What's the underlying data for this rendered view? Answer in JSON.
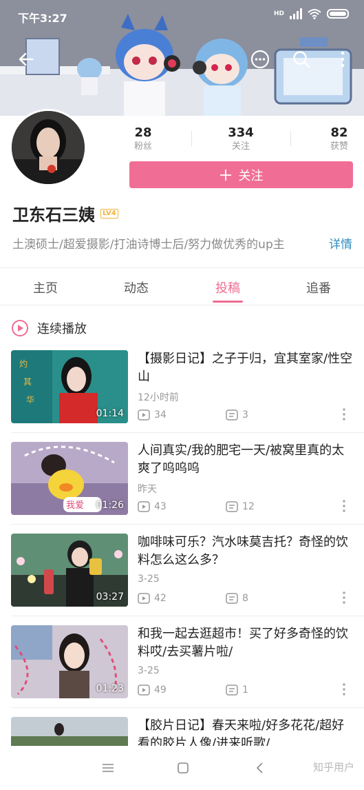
{
  "status_bar": {
    "time": "下午3:27",
    "network": "HD"
  },
  "topbar": {
    "back_icon": "back-arrow-icon",
    "more_icon": "more-dots-icon",
    "search_icon": "search-icon",
    "menu_icon": "vertical-dots-icon"
  },
  "profile": {
    "name": "卫东石三姨",
    "level": "LV4",
    "bio": "土澳硕士/超爱摄影/打油诗博士后/努力做优秀的up主",
    "detail_label": "详情",
    "follow_label": "关注",
    "stats": [
      {
        "value": "28",
        "label": "粉丝"
      },
      {
        "value": "334",
        "label": "关注"
      },
      {
        "value": "82",
        "label": "获赞"
      }
    ]
  },
  "tabs": [
    {
      "label": "主页",
      "active": false
    },
    {
      "label": "动态",
      "active": false
    },
    {
      "label": "投稿",
      "active": true
    },
    {
      "label": "追番",
      "active": false
    }
  ],
  "autoplay": {
    "label": "连续播放"
  },
  "videos": [
    {
      "title": "【摄影日记】之子于归，宜其室家/性空山",
      "time": "12小时前",
      "plays": "34",
      "danmaku": "3",
      "duration": "01:14"
    },
    {
      "title": "人间真实/我的肥宅一天/被窝里真的太爽了呜呜呜",
      "time": "昨天",
      "plays": "43",
      "danmaku": "12",
      "duration": "01:26"
    },
    {
      "title": "咖啡味可乐？汽水味莫吉托？奇怪的饮料怎么这么多？",
      "time": "3-25",
      "plays": "42",
      "danmaku": "8",
      "duration": "03:27"
    },
    {
      "title": "和我一起去逛超市！买了好多奇怪的饮料哎/去买薯片啦/",
      "time": "3-25",
      "plays": "49",
      "danmaku": "1",
      "duration": "01:23"
    },
    {
      "title": "【胶片日记】春天来啦/好多花花/超好看的胶片人像/进来听歌/",
      "time": "",
      "plays": "",
      "danmaku": "",
      "duration": ""
    }
  ],
  "watermark": "知乎用户",
  "colors": {
    "accent": "#ee6d92",
    "follow_button": "#f06e96",
    "link": "#2f8dbf"
  }
}
